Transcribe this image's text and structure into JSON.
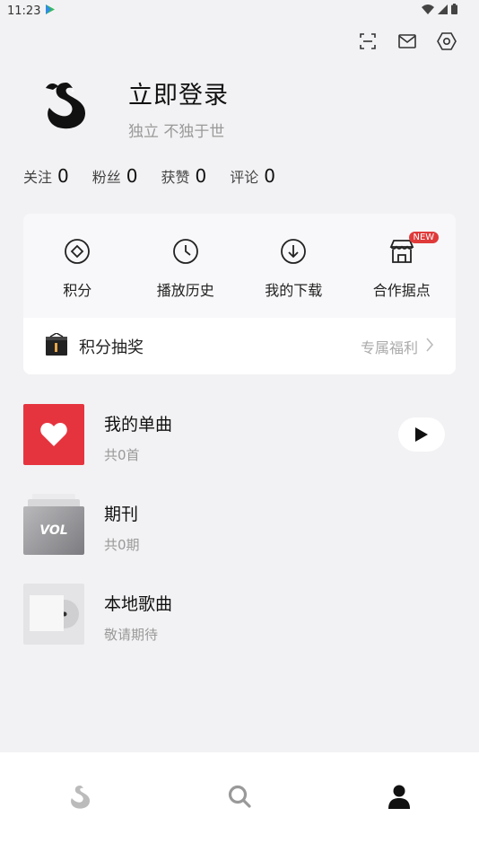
{
  "status_bar": {
    "time": "11:23"
  },
  "top_actions": {
    "icons": [
      "scan-icon",
      "mail-icon",
      "settings-icon"
    ]
  },
  "profile": {
    "login_text": "立即登录",
    "slogan": "独立 不独于世"
  },
  "stats": [
    {
      "label": "关注",
      "value": "0"
    },
    {
      "label": "粉丝",
      "value": "0"
    },
    {
      "label": "获赞",
      "value": "0"
    },
    {
      "label": "评论",
      "value": "0"
    }
  ],
  "quick_actions": [
    {
      "label": "积分",
      "icon": "points-icon"
    },
    {
      "label": "播放历史",
      "icon": "history-icon"
    },
    {
      "label": "我的下载",
      "icon": "download-icon"
    },
    {
      "label": "合作据点",
      "icon": "store-icon",
      "badge": "NEW"
    }
  ],
  "lottery": {
    "label": "积分抽奖",
    "right_text": "专属福利"
  },
  "library": [
    {
      "title": "我的单曲",
      "subtitle": "共0首"
    },
    {
      "title": "期刊",
      "subtitle": "共0期",
      "thumb_text": "VOL"
    },
    {
      "title": "本地歌曲",
      "subtitle": "敬请期待"
    }
  ],
  "bottom_nav": [
    "home-swan-icon",
    "search-icon",
    "profile-icon"
  ],
  "colors": {
    "accent_red": "#e6343f",
    "badge_red": "#e03a3a",
    "background": "#f2f2f4"
  }
}
